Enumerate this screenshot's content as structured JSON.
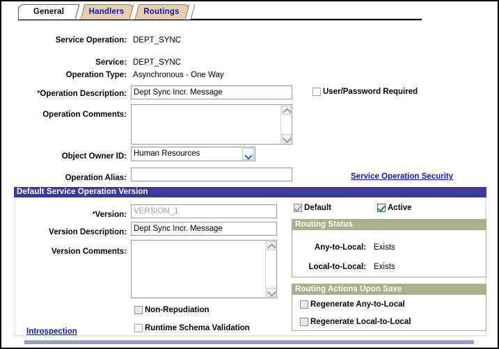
{
  "tabs": [
    {
      "label": "General",
      "state": "active"
    },
    {
      "label": "Handlers",
      "state": "inactive"
    },
    {
      "label": "Routings",
      "state": "inactive"
    }
  ],
  "general": {
    "service_operation_label": "Service Operation:",
    "service_operation_value": "DEPT_SYNC",
    "service_label": "Service:",
    "service_value": "DEPT_SYNC",
    "operation_type_label": "Operation Type:",
    "operation_type_value": "Asynchronous - One Way",
    "operation_description_label": "Operation Description:",
    "operation_description_required": "*",
    "operation_description_value": "Dept Sync Incr. Message",
    "operation_comments_label": "Operation Comments:",
    "operation_comments_value": "",
    "object_owner_id_label": "Object Owner ID:",
    "object_owner_id_value": "Human Resources",
    "operation_alias_label": "Operation Alias:",
    "operation_alias_value": "",
    "user_password_required_label": "User/Password Required",
    "user_password_required_checked": false,
    "service_operation_security_link": "Service Operation Security"
  },
  "version_group": {
    "title": "Default Service Operation Version",
    "version_label": "Version:",
    "version_required": "*",
    "version_value": "VERSION_1",
    "version_description_label": "Version Description:",
    "version_description_value": "Dept Sync Incr. Message",
    "version_comments_label": "Version Comments:",
    "version_comments_value": "",
    "default_label": "Default",
    "default_checked": true,
    "active_label": "Active",
    "active_checked": true,
    "non_repudiation_label": "Non-Repudiation",
    "non_repudiation_checked": false,
    "runtime_schema_validation_label": "Runtime Schema Validation",
    "runtime_schema_validation_checked": false,
    "introspection_link": "Introspection"
  },
  "routing_status": {
    "title": "Routing Status",
    "any_to_local_label": "Any-to-Local:",
    "any_to_local_value": "Exists",
    "local_to_local_label": "Local-to-Local:",
    "local_to_local_value": "Exists"
  },
  "routing_actions": {
    "title": "Routing Actions Upon Save",
    "regenerate_any_to_local_label": "Regenerate Any-to-Local",
    "regenerate_any_to_local_checked": false,
    "regenerate_local_to_local_label": "Regenerate Local-to-Local",
    "regenerate_local_to_local_checked": false
  },
  "colors": {
    "group_header": "#3b3b9e",
    "panel_header": "#a9b08a",
    "tab_inactive": "#e4cfae",
    "link": "#1414c8",
    "bottom_bar": "#9a9ac4"
  }
}
